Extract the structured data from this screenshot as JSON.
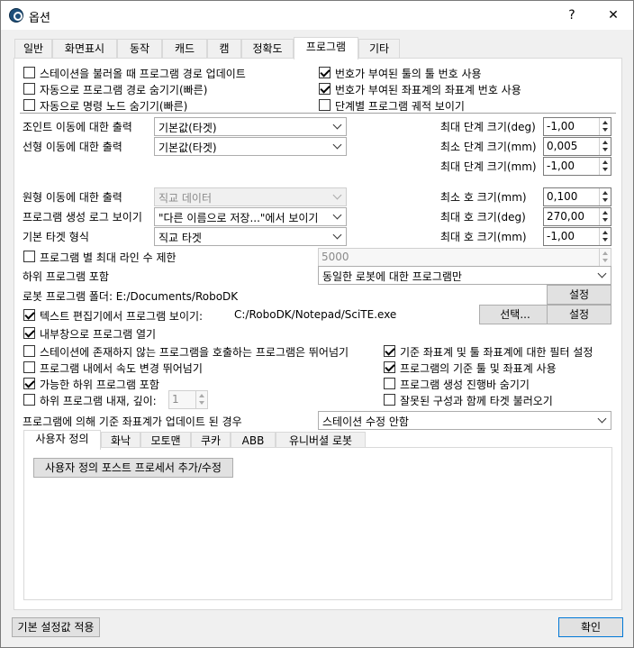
{
  "window": {
    "title": "옵션",
    "help": "?",
    "close": "✕"
  },
  "tabs": [
    "일반",
    "화면표시",
    "동작",
    "캐드",
    "캠",
    "정확도",
    "프로그램",
    "기타"
  ],
  "checks_top_left": [
    {
      "label": "스테이션을 불러올 때 프로그램 경로 업데이트",
      "checked": false
    },
    {
      "label": "자동으로 프로그램 경로 숨기기(빠른)",
      "checked": false
    },
    {
      "label": "자동으로 명령 노드 숨기기(빠른)",
      "checked": false
    }
  ],
  "checks_top_right": [
    {
      "label": "번호가 부여된 툴의 툴 번호 사용",
      "checked": true
    },
    {
      "label": "번호가 부여된 좌표계의 좌표계 번호 사용",
      "checked": true
    },
    {
      "label": "단계별 프로그램 궤적 보이기",
      "checked": false
    }
  ],
  "fields": {
    "joint_output_label": "조인트 이동에 대한 출력",
    "joint_output_value": "기본값(타겟)",
    "linear_output_label": "선형 이동에 대한 출력",
    "linear_output_value": "기본값(타겟)",
    "circular_output_label": "원형 이동에 대한 출력",
    "circular_output_value": "직교 데이터",
    "gen_log_label": "프로그램 생성 로그 보이기",
    "gen_log_value": "\"다른 이름으로 저장...\"에서 보이기",
    "target_type_label": "기본 타겟 형식",
    "target_type_value": "직교 타겟",
    "max_lines_label": "프로그램 별 최대 라인 수 제한",
    "max_lines_value": "5000",
    "subprog_label": "하위 프로그램 포함",
    "subprog_value": "동일한 로봇에 대한 프로그램만",
    "robot_folder_label": "로봇 프로그램 폴더: E:/Documents/RoboDK",
    "editor_label": "텍스트 편집기에서 프로그램 보이기:",
    "editor_path": "C:/RoboDK/Notepad/SciTE.exe",
    "popup_label": "내부창으로 프로그램 열기",
    "frame_update_label": "프로그램에 의해 기준 좌표계가 업데이트 된 경우",
    "frame_update_value": "스테이션 수정 안함"
  },
  "steps": [
    {
      "label": "최대 단계 크기(deg)",
      "value": "-1,00"
    },
    {
      "label": "최소 단계 크기(mm)",
      "value": "0,005"
    },
    {
      "label": "최대 단계 크기(mm)",
      "value": "-1,00"
    },
    {
      "label": "최소 호 크기(mm)",
      "value": "0,100"
    },
    {
      "label": "최대 호 크기(deg)",
      "value": "270,00"
    },
    {
      "label": "최대 호 크기(mm)",
      "value": "-1,00"
    }
  ],
  "buttons": {
    "set1": "설정",
    "select": "선택...",
    "set2": "설정",
    "postproc": "사용자 정의 포스트 프로세서 추가/수정",
    "defaults": "기본 설정값 적용",
    "ok": "확인"
  },
  "checks_lower_left": [
    {
      "label": "스테이션에 존재하지 않는 프로그램을 호출하는 프로그램은 뛰어넘기",
      "checked": false
    },
    {
      "label": "프로그램 내에서 속도 변경 뛰어넘기",
      "checked": false
    },
    {
      "label": "가능한 하위 프로그램 포함",
      "checked": true
    },
    {
      "label": "하위 프로그램 내재, 깊이:",
      "checked": false,
      "depth": "1"
    }
  ],
  "checks_lower_right": [
    {
      "label": "기준 좌표계 및 툴 좌표계에 대한 필터 설정",
      "checked": true
    },
    {
      "label": "프로그램의 기준 툴 및 좌표계 사용",
      "checked": true
    },
    {
      "label": "프로그램 생성 진행바 숨기기",
      "checked": false
    },
    {
      "label": "잘못된 구성과 함께 타겟 불러오기",
      "checked": false
    }
  ],
  "inner_tabs": [
    "사용자 정의",
    "화낙",
    "모토맨",
    "쿠카",
    "ABB",
    "유니버셜 로봇"
  ]
}
